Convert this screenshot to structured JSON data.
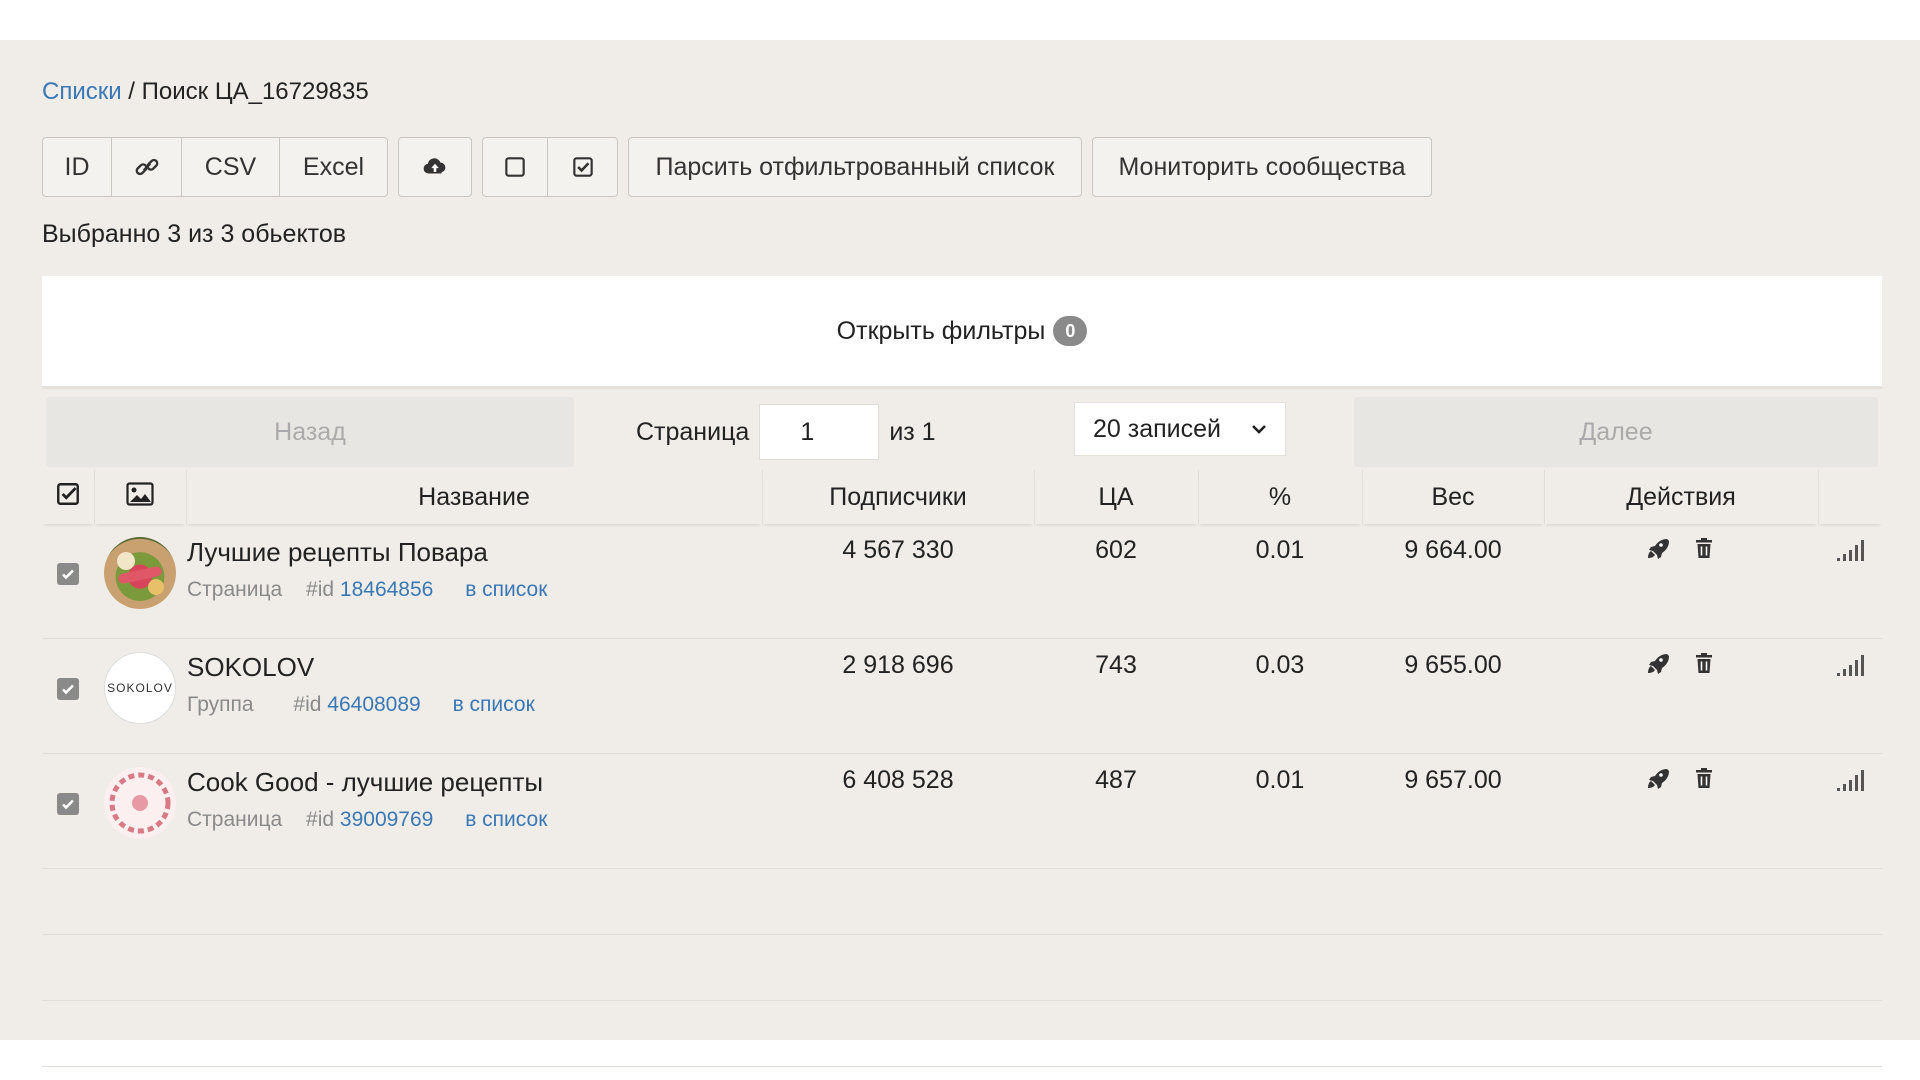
{
  "breadcrumb": {
    "root": "Списки",
    "sep": " / ",
    "current": "Поиск ЦА_16729835"
  },
  "toolbar": {
    "id": "ID",
    "csv": "CSV",
    "excel": "Excel",
    "parse": "Парсить отфильтрованный список",
    "monitor": "Мониторить сообщества"
  },
  "selected_info": "Выбранно 3 из 3 обьектов",
  "filters": {
    "label": "Открыть фильтры",
    "count": "0"
  },
  "pager": {
    "prev": "Назад",
    "page_label": "Страница",
    "page": "1",
    "of": "из 1",
    "per_page": "20 записей",
    "next": "Далее"
  },
  "table": {
    "headers": {
      "name": "Название",
      "subscribers": "Подписчики",
      "ca": "ЦА",
      "percent": "%",
      "weight": "Вес",
      "actions": "Действия"
    },
    "rows": [
      {
        "name": "Лучшие рецепты Повара",
        "type": "Страница",
        "id_prefix": "#id",
        "id": "18464856",
        "link": "в список",
        "subscribers": "4 567 330",
        "ca": "602",
        "percent": "0.01",
        "weight": "9 664.00"
      },
      {
        "name": "SOKOLOV",
        "type": "Группа",
        "id_prefix": "#id",
        "id": "46408089",
        "link": "в список",
        "subscribers": "2 918 696",
        "ca": "743",
        "percent": "0.03",
        "weight": "9 655.00",
        "avatar_text": "SOKOLOV"
      },
      {
        "name": "Cook Good - лучшие рецепты",
        "type": "Страница",
        "id_prefix": "#id",
        "id": "39009769",
        "link": "в список",
        "subscribers": "6 408 528",
        "ca": "487",
        "percent": "0.01",
        "weight": "9 657.00"
      }
    ]
  },
  "colors": {
    "link": "#3a78b5",
    "page_bg": "#f0ede8",
    "muted": "#8a8a8a"
  }
}
